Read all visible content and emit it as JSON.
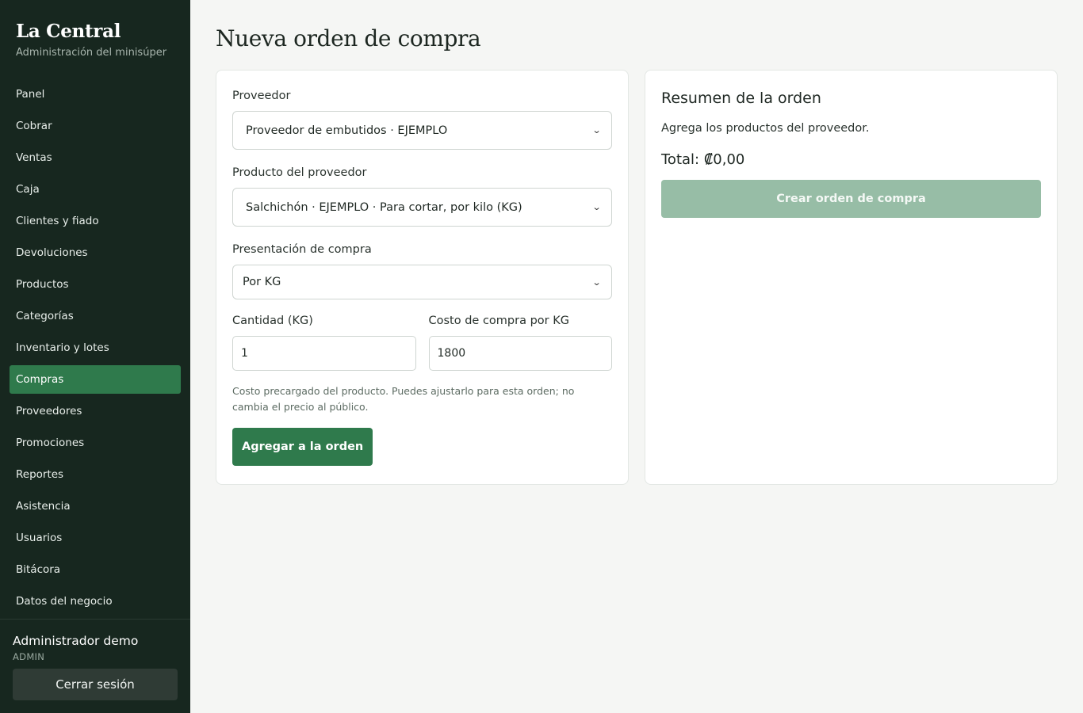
{
  "brand": {
    "title": "La Central",
    "subtitle": "Administración del minisúper"
  },
  "nav": {
    "items": [
      {
        "label": "Panel"
      },
      {
        "label": "Cobrar"
      },
      {
        "label": "Ventas"
      },
      {
        "label": "Caja"
      },
      {
        "label": "Clientes y fiado"
      },
      {
        "label": "Devoluciones"
      },
      {
        "label": "Productos"
      },
      {
        "label": "Categorías"
      },
      {
        "label": "Inventario y lotes"
      },
      {
        "label": "Compras"
      },
      {
        "label": "Proveedores"
      },
      {
        "label": "Promociones"
      },
      {
        "label": "Reportes"
      },
      {
        "label": "Asistencia"
      },
      {
        "label": "Usuarios"
      },
      {
        "label": "Bitácora"
      },
      {
        "label": "Datos del negocio"
      }
    ],
    "active": "Compras"
  },
  "user": {
    "name": "Administrador demo",
    "role": "ADMIN",
    "logout_label": "Cerrar sesión"
  },
  "page": {
    "title": "Nueva orden de compra"
  },
  "form": {
    "supplier_label": "Proveedor",
    "supplier_value": "Proveedor de embutidos · EJEMPLO",
    "product_label": "Producto del proveedor",
    "product_value": "Salchichón · EJEMPLO · Para cortar, por kilo (KG)",
    "presentation_label": "Presentación de compra",
    "presentation_value": "Por KG",
    "quantity_label": "Cantidad (KG)",
    "quantity_value": "1",
    "cost_label": "Costo de compra por KG",
    "cost_value": "1800",
    "hint": "Costo precargado del producto. Puedes ajustarlo para esta orden; no cambia el precio al público.",
    "add_button": "Agregar a la orden"
  },
  "summary": {
    "title": "Resumen de la orden",
    "empty_text": "Agrega los productos del proveedor.",
    "total": "Total: ₡0,00",
    "create_button": "Crear orden de compra"
  },
  "colors": {
    "sidebar_bg": "#17271f",
    "accent": "#2f7a4c",
    "accent_disabled": "#97bda6",
    "page_bg": "#f5f6f4"
  }
}
